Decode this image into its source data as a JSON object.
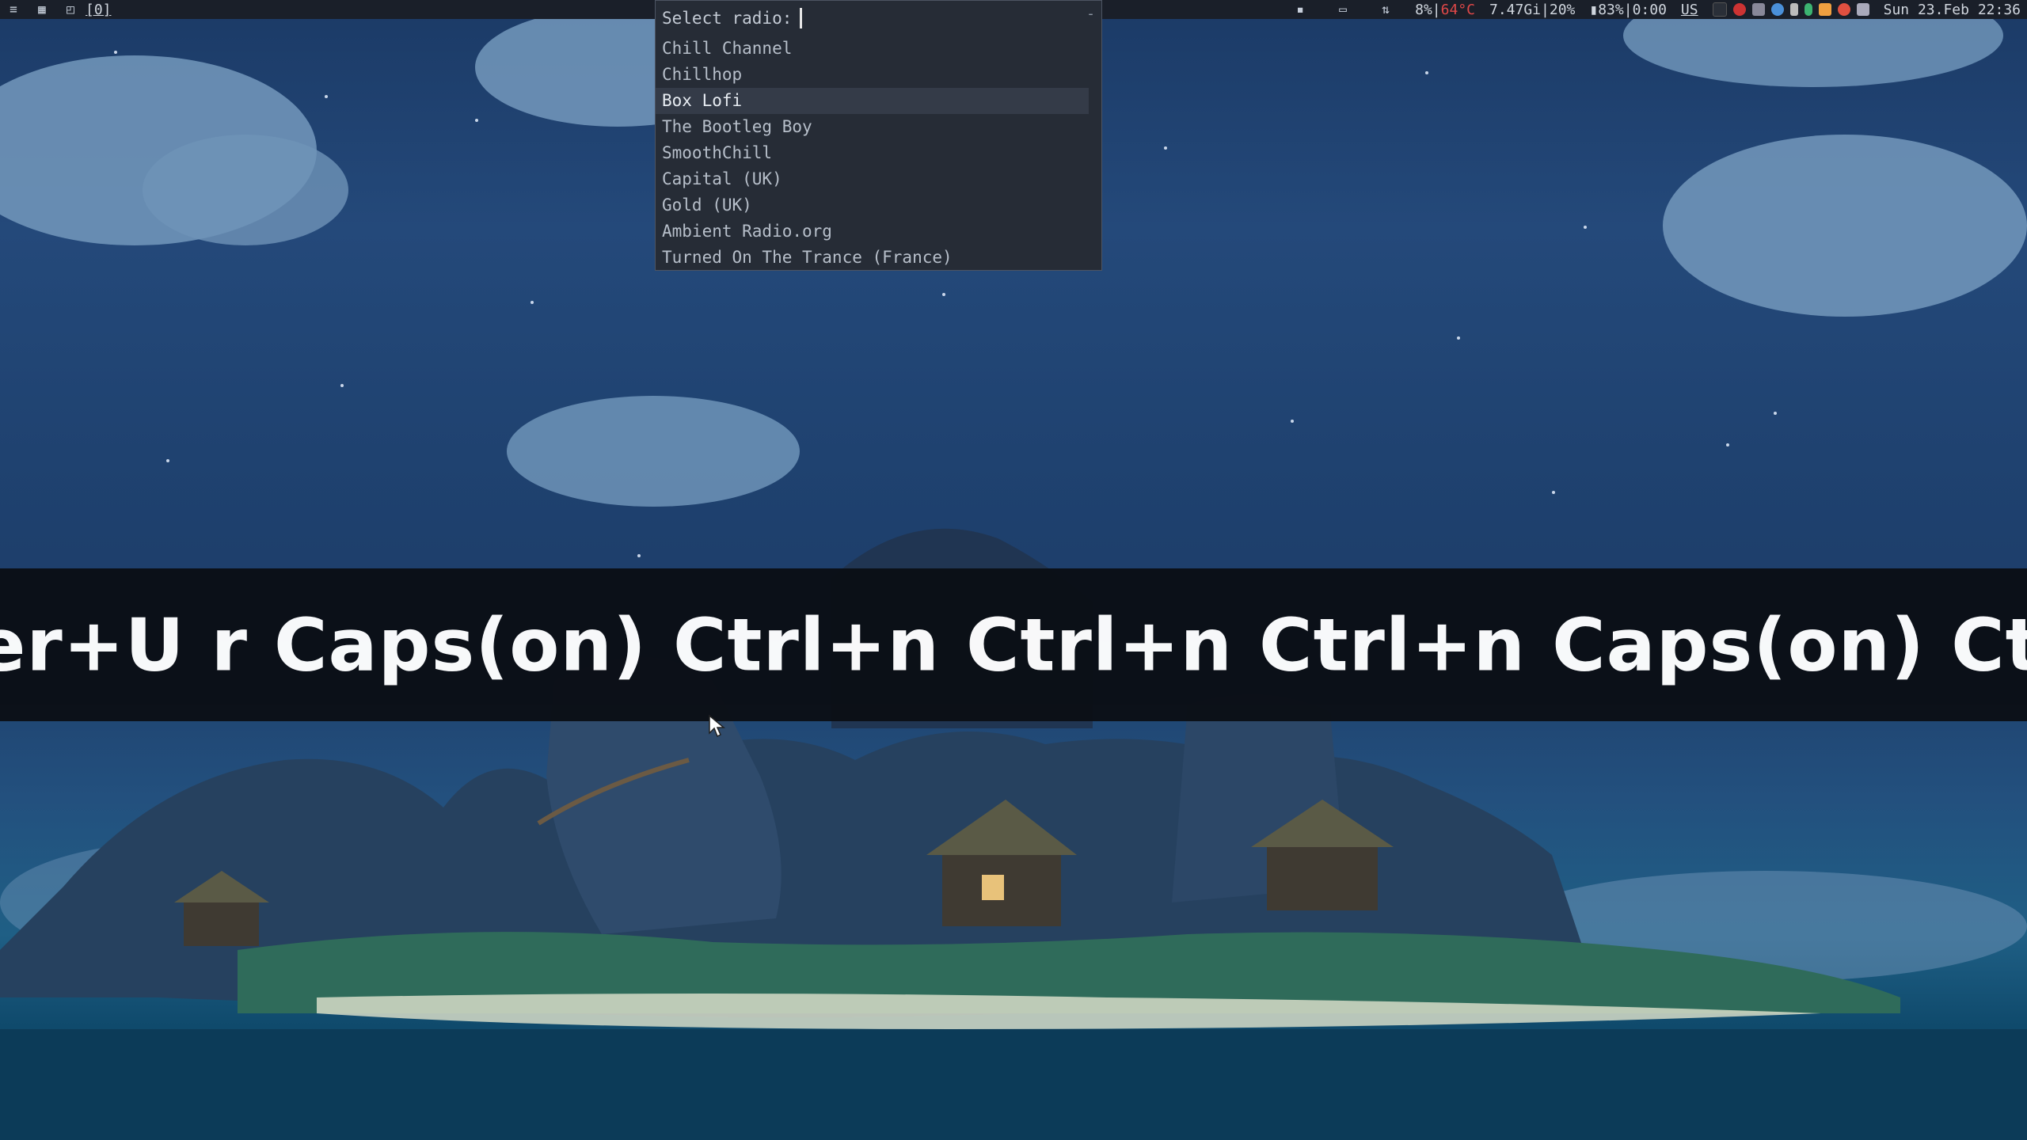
{
  "topbar": {
    "workspace_label": "[0]",
    "cpu": "8%",
    "temperature": "64°C",
    "memory": "7.47Gi|20%",
    "battery": "83%|0:00",
    "keyboard_layout": "US",
    "datetime": "Sun 23.Feb 22:36"
  },
  "selector": {
    "prompt": "Select radio:",
    "close_glyph": "-",
    "options": [
      {
        "label": "Chill Channel"
      },
      {
        "label": "Chillhop"
      },
      {
        "label": "Box Lofi"
      },
      {
        "label": "The Bootleg Boy"
      },
      {
        "label": "SmoothChill"
      },
      {
        "label": "Capital (UK)"
      },
      {
        "label": "Gold (UK)"
      },
      {
        "label": "Ambient Radio.org"
      },
      {
        "label": "Turned On The Trance (France)"
      }
    ],
    "selected_index": 2
  },
  "key_overlay": {
    "text": "er+U r Caps(on) Ctrl+n Ctrl+n Ctrl+n Caps(on) Ctrl+p"
  },
  "colors": {
    "bar_bg": "#1a1f29",
    "menu_bg": "#262c36",
    "menu_selected": "#343b48",
    "temp_alert": "#e04848",
    "overlay_bg": "#0b0f16"
  }
}
